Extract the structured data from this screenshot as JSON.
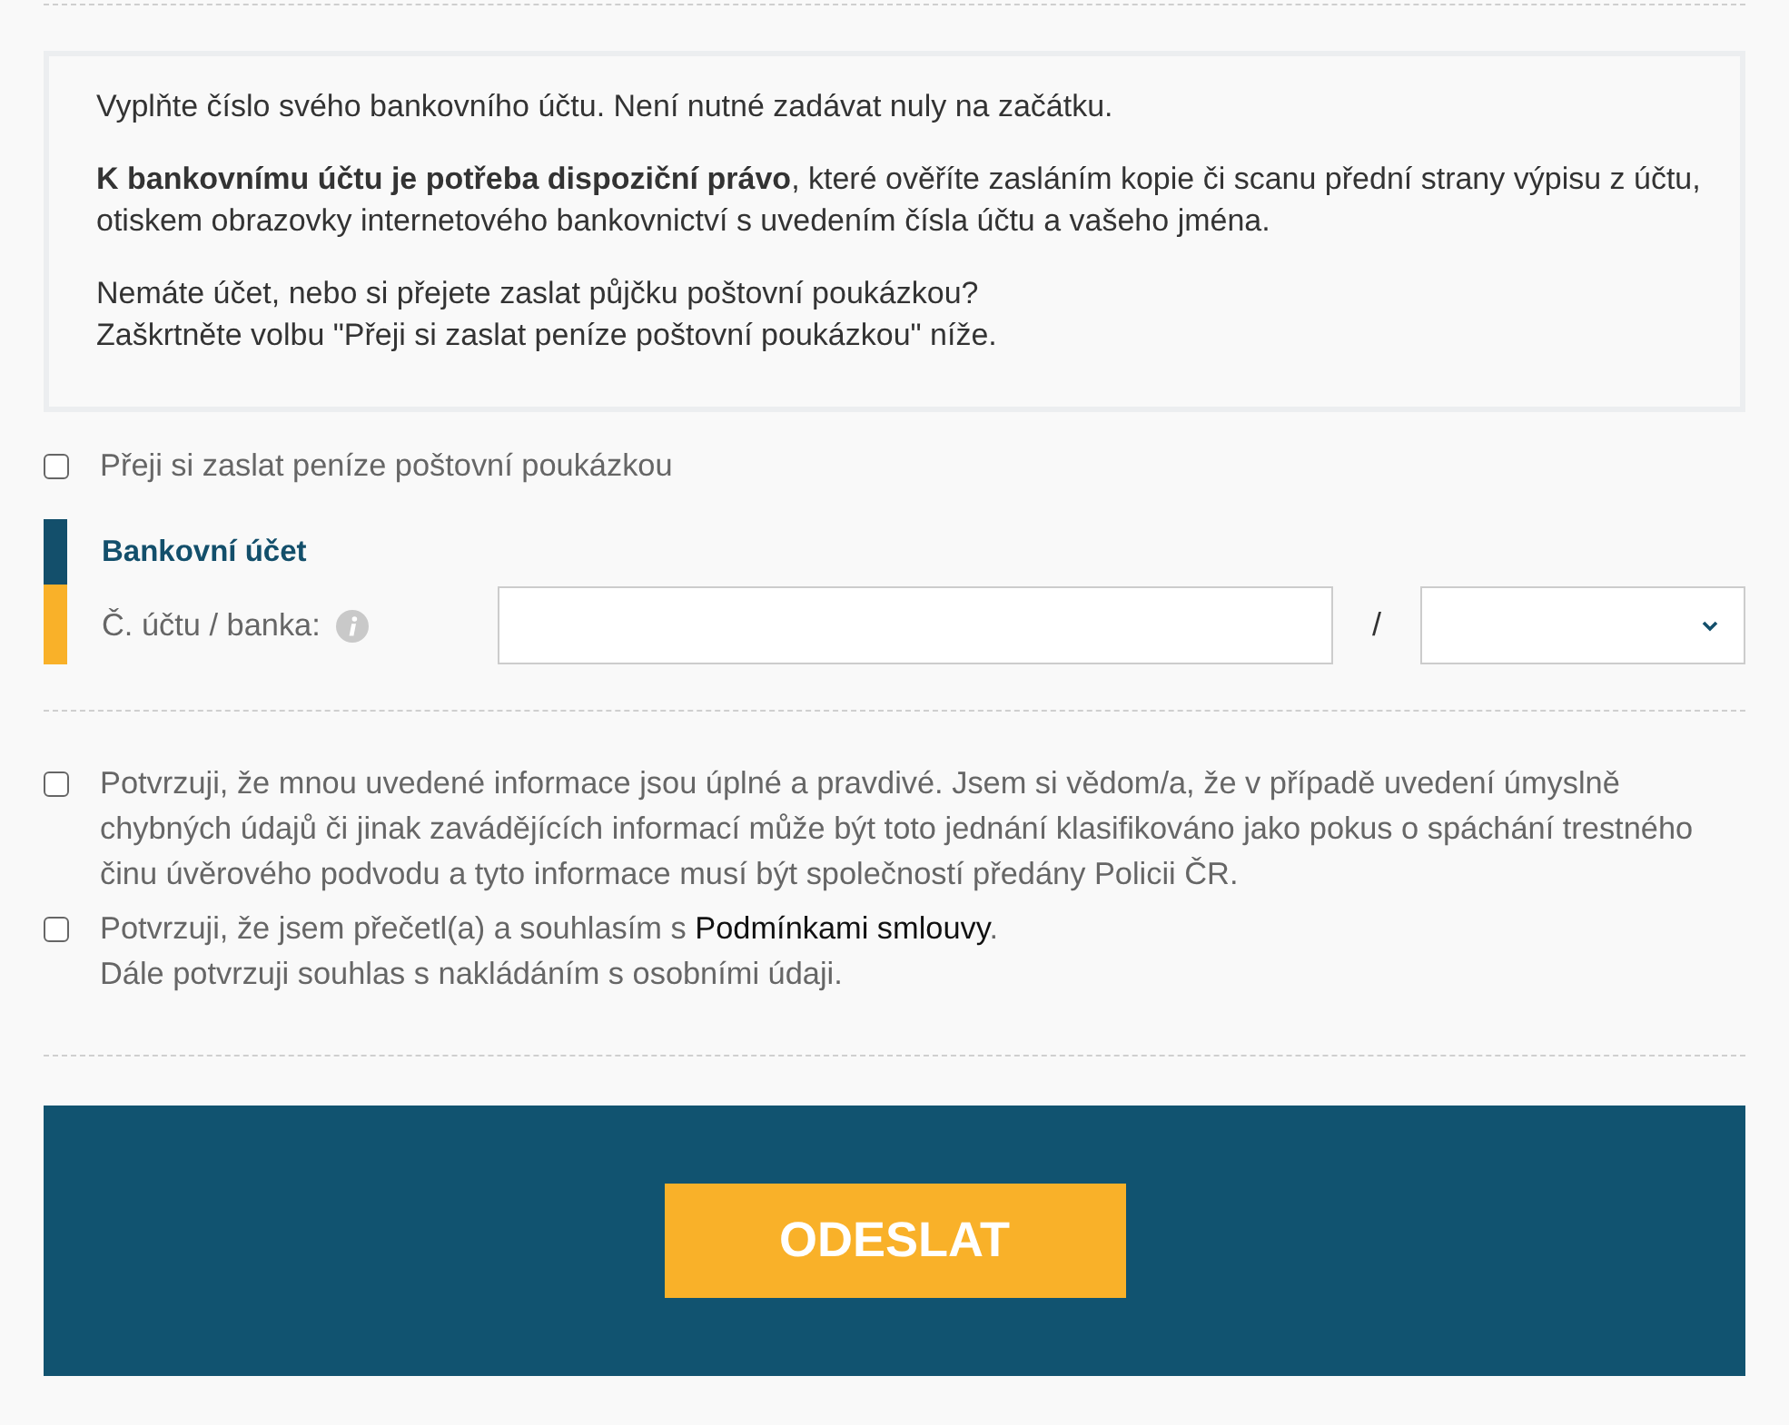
{
  "info_box": {
    "paragraphs": [
      {
        "lines": [
          "Vyplňte číslo svého bankovního účtu. Není nutné zadávat nuly na začátku."
        ]
      },
      {
        "lines": [
          "**K bankovnímu účtu je potřeba dispoziční právo**, které ověříte zasláním kopie či scanu přední strany výpisu z účtu, otiskem obrazovky internetového bankovnictví s uvedením čísla účtu a vašeho jména."
        ]
      },
      {
        "lines": [
          "Nemáte účet, nebo si přejete zaslat půjčku poštovní poukázkou?",
          "Zaškrtněte volbu \"Přeji si zaslat peníze poštovní poukázkou\" níže."
        ]
      }
    ]
  },
  "postal_option": {
    "label": "Přeji si zaslat peníze poštovní poukázkou",
    "checked": false
  },
  "bank_section": {
    "title": "Bankovní účet",
    "field_label": "Č. účtu / banka:",
    "separator": "/"
  },
  "consents": [
    {
      "checked": false,
      "text": "Potvrzuji, že mnou uvedené informace jsou úplné a pravdivé. Jsem si vědom/a, že v případě uvedení úmyslně chybných údajů či jinak zavádějících informací může být toto jednání klasifikováno jako pokus o spáchání trestného činu úvěrového podvodu a tyto informace musí být společností předány Policii ČR."
    },
    {
      "checked": false,
      "text": "Potvrzuji, že jsem přečetl(a) a souhlasím s",
      "link": "Podmínkami smlouvy",
      "text_after": ".",
      "note": "Dále potvrzuji souhlas s nakládáním s osobními údaji."
    }
  ],
  "submit_button": {
    "label": "ODESLAT"
  }
}
